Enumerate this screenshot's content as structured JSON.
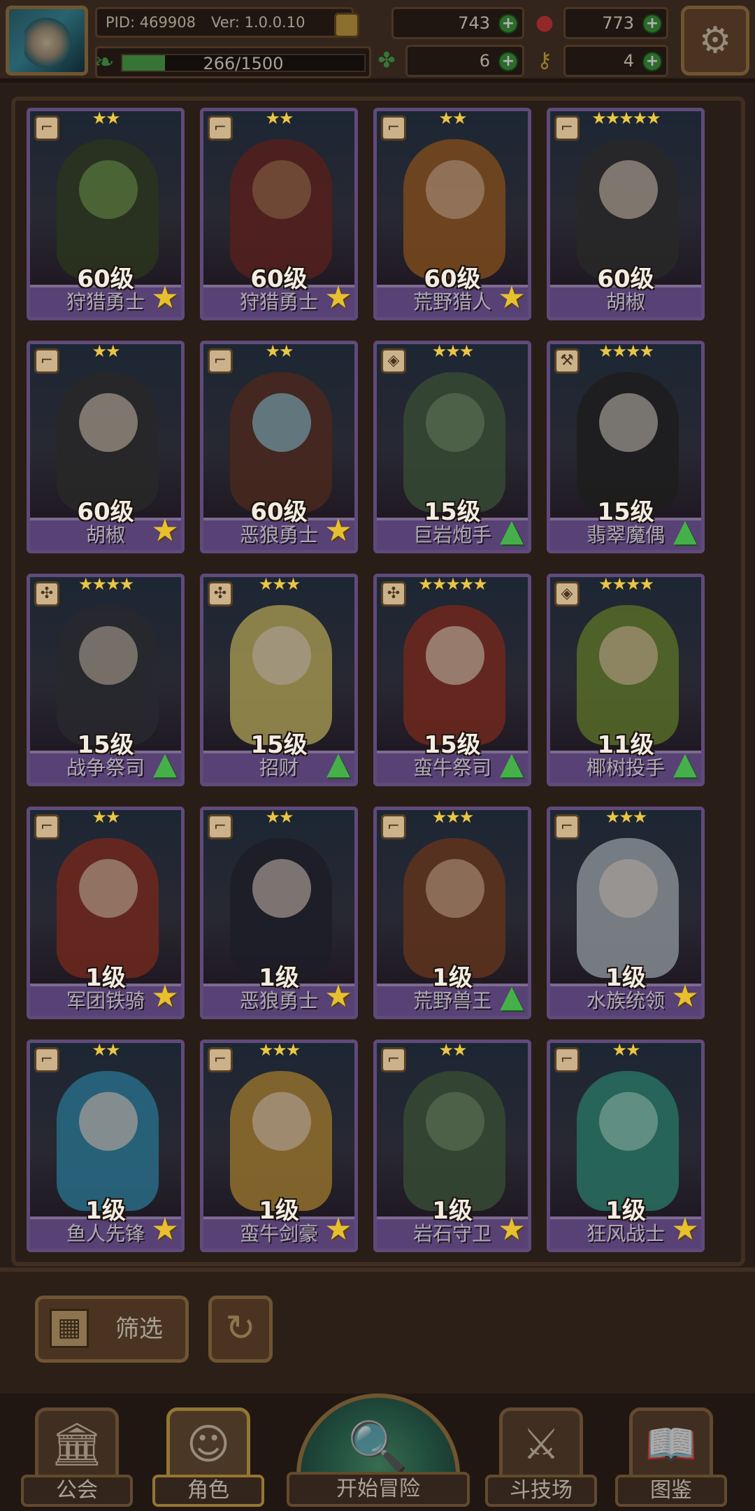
{
  "header": {
    "pid_label": "PID: 469908",
    "version_label": "Ver: 1.0.0.10",
    "exp": {
      "text": "266/1500",
      "current": 266,
      "max": 1500
    },
    "currencies": {
      "gold": {
        "value": "743",
        "icon": "coin-icon",
        "color": "#c9a042"
      },
      "gems": {
        "value": "773",
        "icon": "red-gem-icon",
        "color": "#d23a3a"
      },
      "clover": {
        "value": "6",
        "icon": "clover-icon",
        "color": "#4fa850"
      },
      "ticket": {
        "value": "4",
        "icon": "key-icon",
        "color": "#d8b040"
      }
    },
    "plus_symbol": "+"
  },
  "heroes": [
    {
      "name": "狩猎勇士",
      "level": "60级",
      "stars": "★★",
      "badge": "star",
      "class_icon": "boot-icon",
      "fig": "#3d4b2a",
      "face": "#7ea858"
    },
    {
      "name": "狩猎勇士",
      "level": "60级",
      "stars": "★★",
      "badge": "star",
      "class_icon": "boot-icon",
      "fig": "#7a2e2a",
      "face": "#b07a58"
    },
    {
      "name": "荒野猎人",
      "level": "60级",
      "stars": "★★",
      "badge": "star",
      "class_icon": "boot-icon",
      "fig": "#b06a2a",
      "face": "#e0b898"
    },
    {
      "name": "胡椒",
      "level": "60级",
      "stars": "★★★★★",
      "badge": "none",
      "class_icon": "boot-icon",
      "fig": "#3a3a3a",
      "face": "#e0d0c0"
    },
    {
      "name": "胡椒",
      "level": "60级",
      "stars": "★★",
      "badge": "star",
      "class_icon": "boot-icon",
      "fig": "#3a3a3a",
      "face": "#e0d0c0"
    },
    {
      "name": "恶狼勇士",
      "level": "60级",
      "stars": "★★",
      "badge": "star",
      "class_icon": "boot-icon",
      "fig": "#6a3a2a",
      "face": "#9ad0e0"
    },
    {
      "name": "巨岩炮手",
      "level": "15级",
      "stars": "★★★",
      "badge": "tree",
      "class_icon": "shield-icon",
      "fig": "#4e6a4a",
      "face": "#7a9a70"
    },
    {
      "name": "翡翠魔偶",
      "level": "15级",
      "stars": "★★★★",
      "badge": "tree",
      "class_icon": "wrench-icon",
      "fig": "#2a2a2a",
      "face": "#d8d0c8"
    },
    {
      "name": "战争祭司",
      "level": "15级",
      "stars": "★★★★",
      "badge": "tree",
      "class_icon": "cross-icon",
      "fig": "#3a3a42",
      "face": "#d0c0b0"
    },
    {
      "name": "招财",
      "level": "15级",
      "stars": "★★★",
      "badge": "tree",
      "class_icon": "cross-icon",
      "fig": "#e0d070",
      "face": "#f0e0c8"
    },
    {
      "name": "蛮牛祭司",
      "level": "15级",
      "stars": "★★★★★",
      "badge": "tree",
      "class_icon": "cross-icon",
      "fig": "#a03a2a",
      "face": "#f0d8c0"
    },
    {
      "name": "椰树投手",
      "level": "11级",
      "stars": "★★★★",
      "badge": "tree",
      "class_icon": "shield-icon",
      "fig": "#7a9a3a",
      "face": "#e8d0a8"
    },
    {
      "name": "军团铁骑",
      "level": "1级",
      "stars": "★★",
      "badge": "star",
      "class_icon": "boot-icon",
      "fig": "#a03a2a",
      "face": "#e8c8b0"
    },
    {
      "name": "恶狼勇士",
      "level": "1级",
      "stars": "★★",
      "badge": "star",
      "class_icon": "boot-icon",
      "fig": "#2a2a3a",
      "face": "#e0d0c8"
    },
    {
      "name": "荒野兽王",
      "level": "1级",
      "stars": "★★★",
      "badge": "tree",
      "class_icon": "boot-icon",
      "fig": "#8a4a2a",
      "face": "#e0b898"
    },
    {
      "name": "水族统领",
      "level": "1级",
      "stars": "★★★",
      "badge": "star",
      "class_icon": "boot-icon",
      "fig": "#c0c8d0",
      "face": "#e8e0d8"
    },
    {
      "name": "鱼人先锋",
      "level": "1级",
      "stars": "★★",
      "badge": "star",
      "class_icon": "boot-icon",
      "fig": "#3a9ac0",
      "face": "#e8e0d8"
    },
    {
      "name": "蛮牛剑豪",
      "level": "1级",
      "stars": "★★★",
      "badge": "star",
      "class_icon": "boot-icon",
      "fig": "#d0a040",
      "face": "#f0d8c0"
    },
    {
      "name": "岩石守卫",
      "level": "1级",
      "stars": "★★",
      "badge": "star",
      "class_icon": "boot-icon",
      "fig": "#4e6a4a",
      "face": "#7a9a70"
    },
    {
      "name": "狂风战士",
      "level": "1级",
      "stars": "★★",
      "badge": "star",
      "class_icon": "boot-icon",
      "fig": "#3aa08a",
      "face": "#a8e0d0"
    }
  ],
  "controls": {
    "filter_label": "筛选",
    "filter_icon": "grid-icon",
    "refresh_icon": "refresh-icon"
  },
  "bottom_nav": {
    "guild": {
      "label": "公会",
      "icon": "guild-hall-icon"
    },
    "characters": {
      "label": "角色",
      "icon": "character-face-icon",
      "active": true
    },
    "adventure": {
      "label": "开始冒险",
      "icon": "map-magnifier-icon"
    },
    "arena": {
      "label": "斗技场",
      "icon": "crossed-swords-icon"
    },
    "codex": {
      "label": "图鉴",
      "icon": "book-icon"
    }
  }
}
